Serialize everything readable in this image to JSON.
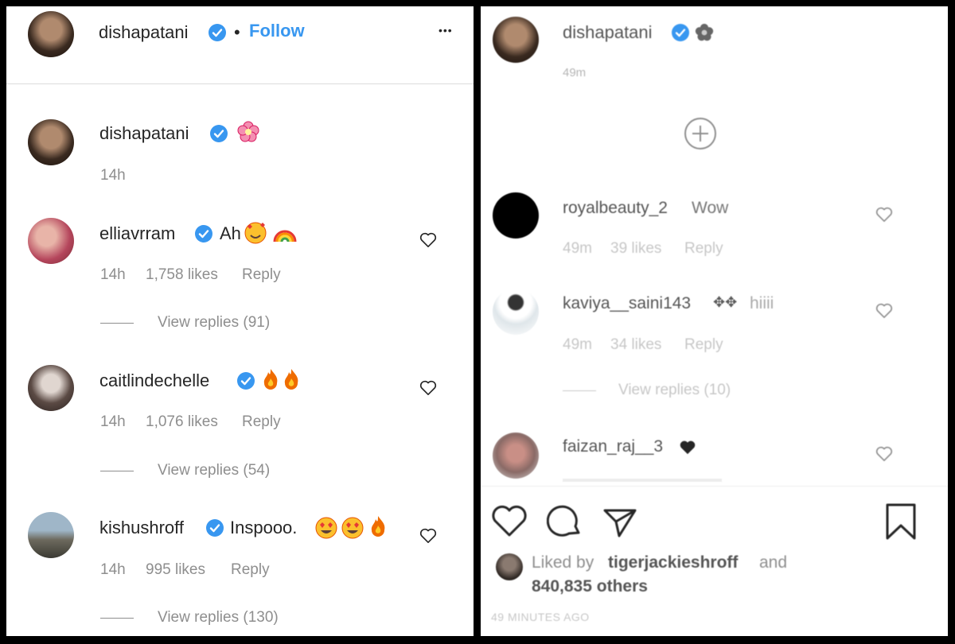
{
  "left": {
    "header": {
      "username": "dishapatani",
      "dot": "•",
      "follow": "Follow",
      "more": "•••"
    },
    "caption": {
      "username": "dishapatani",
      "time": "14h"
    },
    "comments": [
      {
        "username": "elliavrram",
        "text": "Ah",
        "time": "14h",
        "likes": "1,758 likes",
        "reply": "Reply",
        "view_replies": "View replies (91)"
      },
      {
        "username": "caitlindechelle",
        "text": "",
        "time": "14h",
        "likes": "1,076 likes",
        "reply": "Reply",
        "view_replies": "View replies (54)"
      },
      {
        "username": "kishushroff",
        "text": "Inspooo.",
        "time": "14h",
        "likes": "995 likes",
        "reply": "Reply",
        "view_replies": "View replies (130)"
      }
    ]
  },
  "right": {
    "header": {
      "username": "dishapatani",
      "time": "49m"
    },
    "comments": [
      {
        "username": "royalbeauty_2",
        "text": "Wow",
        "time": "49m",
        "likes": "39 likes",
        "reply": "Reply"
      },
      {
        "username": "kaviya__saini143",
        "text": "hiiii",
        "time": "49m",
        "likes": "34 likes",
        "reply": "Reply",
        "view_replies": "View replies (10)"
      },
      {
        "username": "faizan_raj__3",
        "text": ""
      }
    ],
    "liked_by": {
      "prefix": "Liked by",
      "user": "tigerjackieshroff",
      "and": "and",
      "others": "840,835 others"
    },
    "posted": "49 MINUTES AGO"
  },
  "colors": {
    "link": "#3897f0",
    "text": "#262626",
    "meta": "#8e8e8e"
  }
}
